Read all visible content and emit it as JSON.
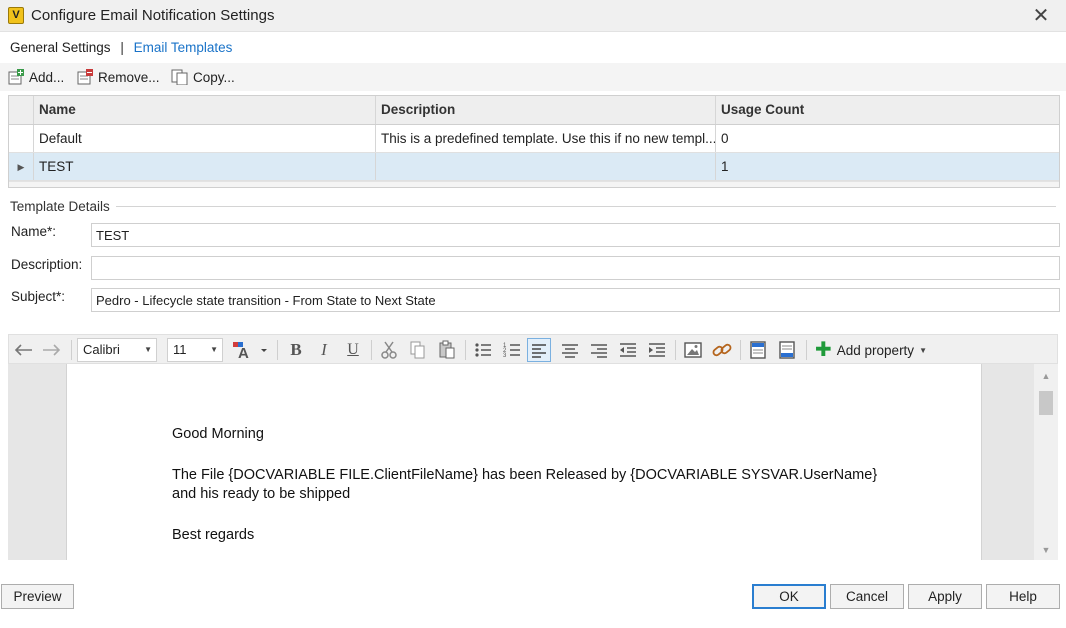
{
  "window": {
    "title": "Configure Email Notification Settings",
    "app_icon_letter": "V",
    "close_glyph": "✕"
  },
  "tabs": {
    "general": "General Settings",
    "separator": "|",
    "email": "Email Templates"
  },
  "grid_toolbar": {
    "add": "Add...",
    "remove": "Remove...",
    "copy": "Copy..."
  },
  "grid": {
    "columns": [
      "Name",
      "Description",
      "Usage Count"
    ],
    "rows": [
      {
        "indicator": "",
        "name": "Default",
        "description": "This is a predefined template. Use this if no new templ...",
        "usage": "0"
      },
      {
        "indicator": "▶",
        "name": "TEST",
        "description": "",
        "usage": "1"
      }
    ]
  },
  "details": {
    "section_label": "Template Details",
    "name_label": "Name*:",
    "name_value": "TEST",
    "description_label": "Description:",
    "description_value": "",
    "subject_label": "Subject*:",
    "subject_value": "Pedro - Lifecycle state transition - From State to Next State"
  },
  "editor_toolbar": {
    "font": "Calibri",
    "size": "11",
    "add_property": "Add property",
    "icons": [
      "undo-icon",
      "redo-icon",
      "font-color-icon",
      "bold-icon",
      "italic-icon",
      "underline-icon",
      "cut-icon",
      "copy-icon",
      "paste-icon",
      "bullet-list-icon",
      "numbered-list-icon",
      "align-left-icon",
      "align-center-icon",
      "align-right-icon",
      "outdent-icon",
      "indent-icon",
      "image-icon",
      "link-icon",
      "header-icon",
      "footer-icon",
      "plus-icon"
    ]
  },
  "editor": {
    "lines": [
      "Good Morning",
      "The File {DOCVARIABLE FILE.ClientFileName} has been Released by {DOCVARIABLE SYSVAR.UserName}",
      "and his ready to be shipped",
      "Best regards"
    ]
  },
  "buttons": {
    "preview": "Preview",
    "ok": "OK",
    "cancel": "Cancel",
    "apply": "Apply",
    "help": "Help"
  },
  "colors": {
    "accent_link": "#1a73c8",
    "selected_row": "#dbeaf5",
    "default_button_border": "#2a7ed0",
    "add_property_plus": "#1f9a3a"
  }
}
